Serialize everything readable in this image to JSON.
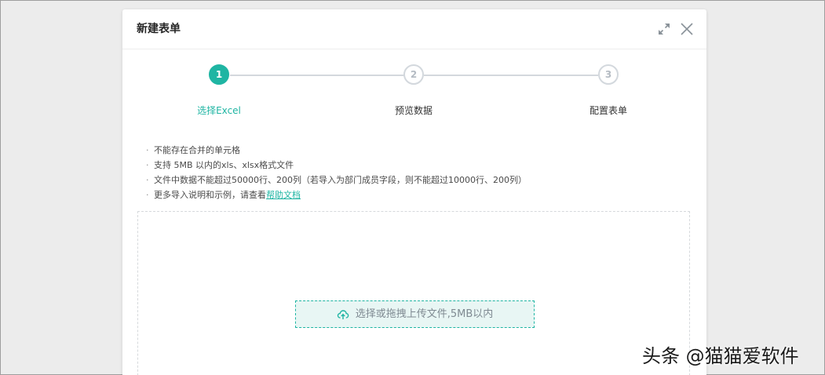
{
  "dialog": {
    "title": "新建表单"
  },
  "steps": [
    {
      "number": "1",
      "label": "选择Excel",
      "state": "active"
    },
    {
      "number": "2",
      "label": "预览数据",
      "state": "inactive"
    },
    {
      "number": "3",
      "label": "配置表单",
      "state": "inactive"
    }
  ],
  "notes": {
    "item_1": "不能存在合并的单元格",
    "item_2": "支持 5MB 以内的xls、xlsx格式文件",
    "item_3": "文件中数据不能超过50000行、200列（若导入为部门成员字段，则不能超过10000行、200列）",
    "item_4_prefix": "更多导入说明和示例，请查看",
    "item_4_link": "帮助文档"
  },
  "upload": {
    "label": "选择或拖拽上传文件,5MB以内"
  },
  "watermark": {
    "text": "头条 @猫猫爱软件"
  },
  "colors": {
    "accent": "#1fb5a3",
    "step_inactive": "#d3d8dd",
    "background": "#ececec"
  },
  "icons": {
    "expand": "expand-icon",
    "close": "close-icon",
    "upload": "cloud-upload-icon"
  }
}
